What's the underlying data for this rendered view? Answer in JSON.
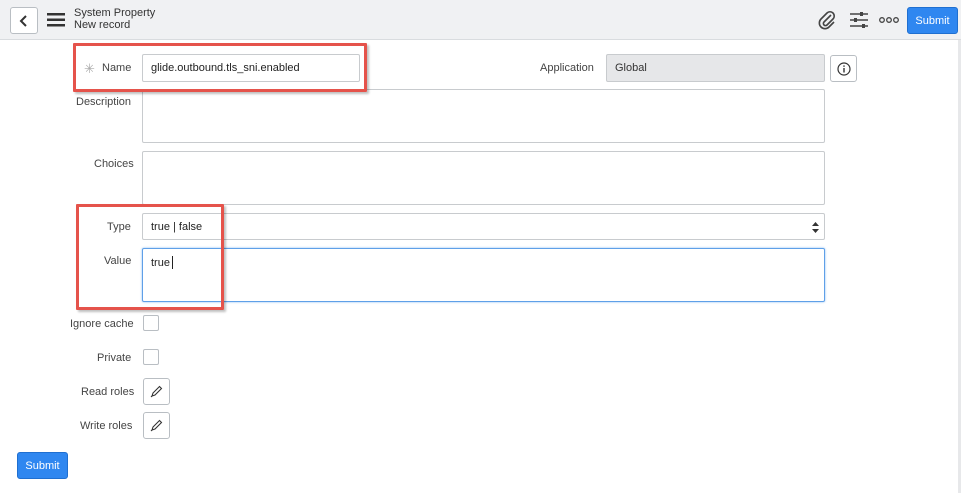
{
  "header": {
    "title": "System Property",
    "subtitle": "New record",
    "submit_label": "Submit"
  },
  "form": {
    "name_label": "Name",
    "name_value": "glide.outbound.tls_sni.enabled",
    "application_label": "Application",
    "application_value": "Global",
    "description_label": "Description",
    "choices_label": "Choices",
    "type_label": "Type",
    "type_value": "true | false",
    "value_label": "Value",
    "value_value": "true",
    "ignore_cache_label": "Ignore cache",
    "private_label": "Private",
    "read_roles_label": "Read roles",
    "write_roles_label": "Write roles",
    "required_marker": "✳",
    "submit_label": "Submit"
  },
  "colors": {
    "accent": "#2f87f0",
    "highlight": "#e5534b"
  },
  "icons": [
    "back-icon",
    "menu-icon",
    "attachment-icon",
    "settings-sliders-icon",
    "more-icon",
    "info-icon",
    "pencil-icon",
    "select-arrows-icon"
  ]
}
